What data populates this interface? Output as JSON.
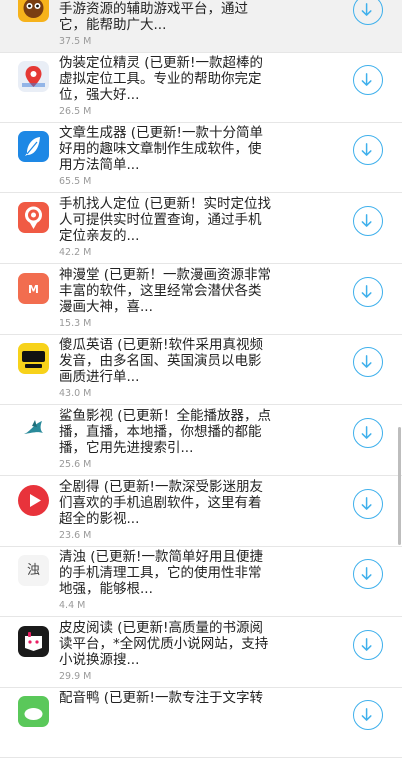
{
  "apps": [
    {
      "desc": "悟饭游戏厅 (已更新!一款囊括海量\n手游资源的辅助游戏平台，通过\n它，能帮助广大...",
      "size": "37.5 M",
      "icon": "wufan-monkey-icon"
    },
    {
      "desc": "伪装定位精灵 (已更新!一款超棒的\n虚拟定位工具。专业的帮助你完定\n位，强大好...",
      "size": "26.5 M",
      "icon": "location-pin-icon"
    },
    {
      "desc": "文章生成器 (已更新!一款十分简单\n好用的趣味文章制作生成软件，使\n用方法简单...",
      "size": "65.5 M",
      "icon": "feather-icon"
    },
    {
      "desc": "手机找人定位 (已更新！实时定位找\n人可提供实时位置查询，通过手机\n定位亲友的...",
      "size": "42.2 M",
      "icon": "locate-person-icon"
    },
    {
      "desc": "神漫堂 (已更新！一款漫画资源非常\n丰富的软件，这里经常会潜伏各类\n漫画大神，喜...",
      "size": "15.3 M",
      "icon": "comic-icon"
    },
    {
      "desc": "傻瓜英语 (已更新!软件采用真视频\n发音，由多名国、英国演员以电影\n画质进行单...",
      "size": "43.0 M",
      "icon": "english-book-icon"
    },
    {
      "desc": "鲨鱼影视 (已更新！全能播放器，点\n播，直播，本地播，你想播的都能\n播，它用先进搜索引...",
      "size": "25.6 M",
      "icon": "shark-icon"
    },
    {
      "desc": "全剧得 (已更新!一款深受影迷朋友\n们喜欢的手机追剧软件，这里有着\n超全的影视...",
      "size": "23.6 M",
      "icon": "play-icon"
    },
    {
      "desc": "清浊 (已更新!一款简单好用且便捷\n的手机清理工具，它的使用性非常\n地强，能够根...",
      "size": "4.4 M",
      "icon": "qingzhuo-icon"
    },
    {
      "desc": "皮皮阅读 (已更新!高质量的书源阅\n读平台，*全网优质小说网站，支持\n小说换源搜...",
      "size": "29.9 M",
      "icon": "pipi-read-icon"
    },
    {
      "desc": "配音鸭 (已更新!一款专注于文字转",
      "size": "",
      "icon": "duck-icon"
    }
  ],
  "icons": {
    "wufan-monkey-icon": {
      "bg": "#f6b21b"
    },
    "location-pin-icon": {
      "bg": "#e9eef6"
    },
    "feather-icon": {
      "bg": "#1e88e5"
    },
    "locate-person-icon": {
      "bg": "#f05a44"
    },
    "comic-icon": {
      "bg": "#f26d4f"
    },
    "english-book-icon": {
      "bg": "#f7d21a"
    },
    "shark-icon": {
      "bg": "#ffffff"
    },
    "play-icon": {
      "bg": "#e8333b"
    },
    "qingzhuo-icon": {
      "bg": "#f4f4f4",
      "text": "浊"
    },
    "pipi-read-icon": {
      "bg": "#1a1a1a"
    },
    "duck-icon": {
      "bg": "#5ac85a"
    }
  },
  "colors": {
    "accent": "#3fb0ec",
    "size_text": "#9a9a9a"
  },
  "download_icon": "download-arrow-icon"
}
